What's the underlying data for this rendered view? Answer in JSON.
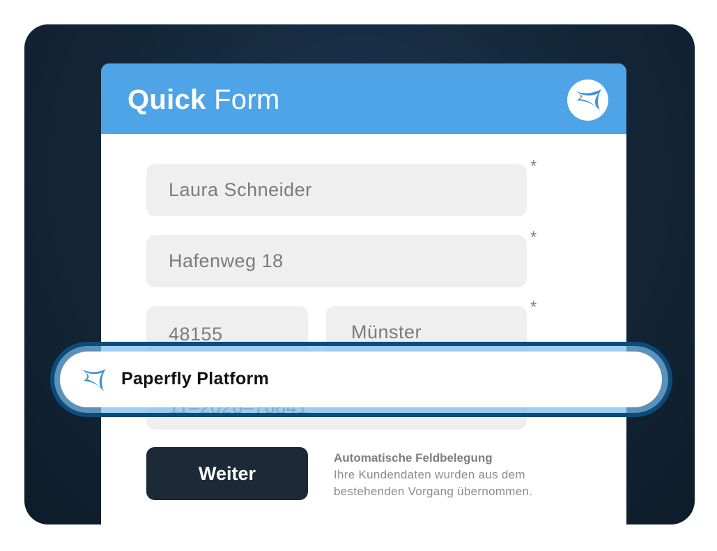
{
  "form": {
    "title_bold": "Quick",
    "title_light": "Form",
    "fields": {
      "name": "Laura Schneider",
      "street": "Hafenweg 18",
      "zip": "48155",
      "city": "Münster",
      "partial": "11–2026–76841"
    },
    "required_marker": "*",
    "submit_label": "Weiter",
    "note_title": "Automatische Feldbelegung",
    "note_line1": "Ihre Kundendaten wurden aus dem",
    "note_line2": "bestehenden Vorgang übernommen."
  },
  "banner": {
    "label": "Paperfly Platform",
    "icon": "paperfly-logo-icon"
  },
  "colors": {
    "header_blue": "#4ea4e6",
    "button_dark": "#1c2a38",
    "field_bg": "#efefef",
    "stage_bg": "#132638"
  }
}
